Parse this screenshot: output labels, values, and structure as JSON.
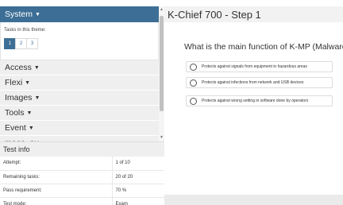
{
  "sidebar": {
    "theme_header": "System",
    "tasks_label": "Tasks in this theme:",
    "pages": [
      "1",
      "2",
      "3"
    ],
    "menu": [
      {
        "label": "Access"
      },
      {
        "label": "Flexi"
      },
      {
        "label": "Images"
      },
      {
        "label": "Tools"
      },
      {
        "label": "Event"
      },
      {
        "label": "meas_av"
      }
    ]
  },
  "test_info": {
    "title": "Test info",
    "rows": [
      {
        "label": "Attempt:",
        "value": "1 of 10"
      },
      {
        "label": "Remaining tasks:",
        "value": "20 of 20"
      },
      {
        "label": "Pass requirement:",
        "value": "70 %"
      },
      {
        "label": "Test mode:",
        "value": "Exam"
      }
    ]
  },
  "main": {
    "title": "K-Chief 700 - Step 1",
    "question": "What is the main function of K-MP (Malware F",
    "options": [
      "Protects against signals from equipment in hazardous areas",
      "Protects against infections from network and USB devices",
      "Protects against wrong setting in software done by operators"
    ]
  },
  "colors": {
    "accent": "#3d6f96",
    "menu_bg": "#efefef"
  },
  "icons": {
    "caret": "caret-down-icon",
    "radio": "radio-unchecked-icon"
  }
}
